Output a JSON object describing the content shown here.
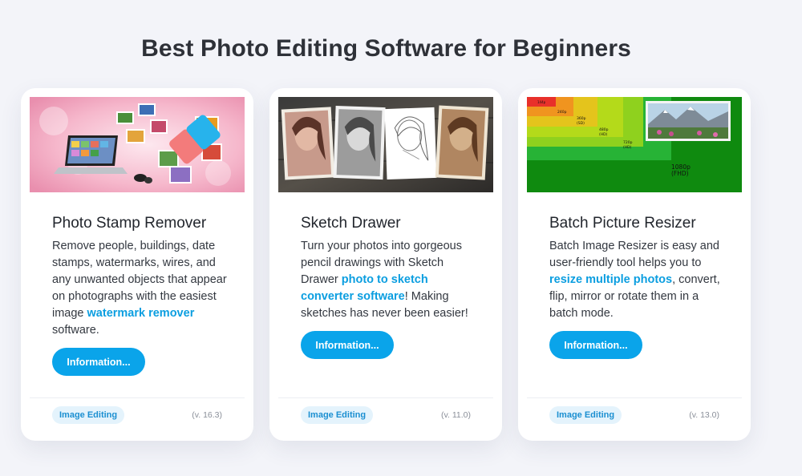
{
  "page": {
    "title": "Best Photo Editing Software for Beginners"
  },
  "cards": [
    {
      "title": "Photo Stamp Remover",
      "desc_before": "Remove people, buildings, date stamps, watermarks, wires, and any unwanted objects that appear on photographs with the easiest image ",
      "link": "watermark remover",
      "desc_after": " software.",
      "button": "Information...",
      "tag": "Image Editing",
      "version": "(v. 16.3)"
    },
    {
      "title": "Sketch Drawer",
      "desc_before": "Turn your photos into gorgeous pencil drawings with Sketch Drawer ",
      "link": "photo to sketch converter software",
      "desc_after": "! Making sketches has never been easier!",
      "button": "Information...",
      "tag": "Image Editing",
      "version": "(v. 11.0)"
    },
    {
      "title": "Batch Picture Resizer",
      "desc_before": "Batch Image Resizer is easy and user-friendly tool helps you to ",
      "link": "resize multiple photos",
      "desc_after": ", convert, flip, mirror or rotate them in a batch mode.",
      "button": "Information...",
      "tag": "Image Editing",
      "version": "(v. 13.0)",
      "thumb_labels": [
        "144p",
        "240p",
        "360p",
        "(SD)",
        "480p",
        "(HD)",
        "720p",
        "(HD)",
        "1080p",
        "(FHD)"
      ]
    }
  ],
  "colors": {
    "accent": "#0aa4ea",
    "link": "#0b9ee0",
    "tag_bg": "#e4f3fc",
    "background": "#f3f4f9"
  },
  "icons": [
    "stamp-remover-thumbnail",
    "sketch-drawer-thumbnail",
    "resizer-thumbnail"
  ]
}
